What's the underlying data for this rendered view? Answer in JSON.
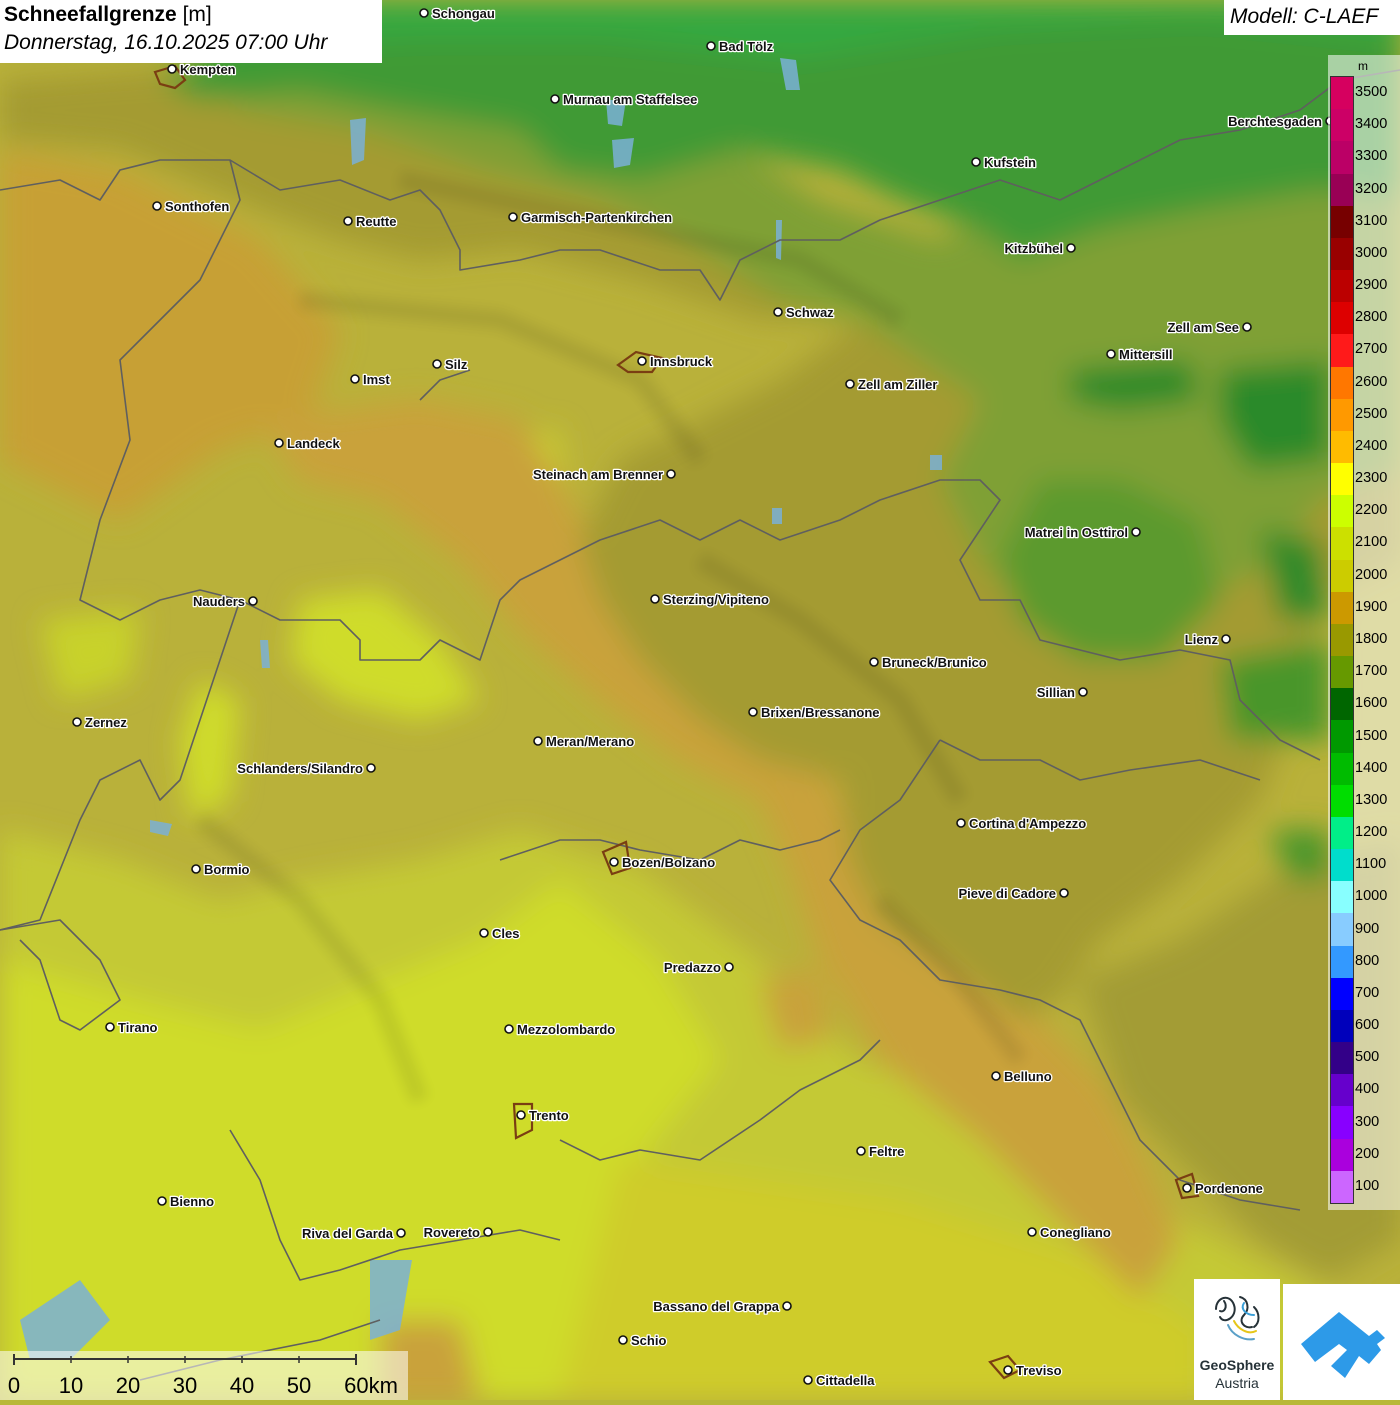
{
  "title": {
    "variable": "Schneefallgrenze",
    "unit": "[m]",
    "datetime": "Donnerstag, 16.10.2025 07:00 Uhr"
  },
  "model": "Modell: C-LAEF",
  "legend": {
    "unit": "m",
    "entries": [
      {
        "label": "3500",
        "color": "#d6005f"
      },
      {
        "label": "3400",
        "color": "#cc0066"
      },
      {
        "label": "3300",
        "color": "#bb0066"
      },
      {
        "label": "3200",
        "color": "#990055"
      },
      {
        "label": "3100",
        "color": "#770000"
      },
      {
        "label": "3000",
        "color": "#990000"
      },
      {
        "label": "2900",
        "color": "#bb0000"
      },
      {
        "label": "2800",
        "color": "#dd0000"
      },
      {
        "label": "2700",
        "color": "#ff1a1a"
      },
      {
        "label": "2600",
        "color": "#ff7700"
      },
      {
        "label": "2500",
        "color": "#ff9900"
      },
      {
        "label": "2400",
        "color": "#ffbb00"
      },
      {
        "label": "2300",
        "color": "#ffff00"
      },
      {
        "label": "2200",
        "color": "#ccff00"
      },
      {
        "label": "2100",
        "color": "#cce000"
      },
      {
        "label": "2000",
        "color": "#cccc00"
      },
      {
        "label": "1900",
        "color": "#cc9900"
      },
      {
        "label": "1800",
        "color": "#999900"
      },
      {
        "label": "1700",
        "color": "#669900"
      },
      {
        "label": "1600",
        "color": "#006600"
      },
      {
        "label": "1500",
        "color": "#009900"
      },
      {
        "label": "1400",
        "color": "#00bb00"
      },
      {
        "label": "1300",
        "color": "#00dd00"
      },
      {
        "label": "1200",
        "color": "#00ee88"
      },
      {
        "label": "1100",
        "color": "#00ddcc"
      },
      {
        "label": "1000",
        "color": "#88ffff"
      },
      {
        "label": "900",
        "color": "#88ccff"
      },
      {
        "label": "800",
        "color": "#3399ff"
      },
      {
        "label": "700",
        "color": "#0000ff"
      },
      {
        "label": "600",
        "color": "#0000bb"
      },
      {
        "label": "500",
        "color": "#330088"
      },
      {
        "label": "400",
        "color": "#6600cc"
      },
      {
        "label": "300",
        "color": "#8800ff"
      },
      {
        "label": "200",
        "color": "#aa00dd"
      },
      {
        "label": "100",
        "color": "#cc66ff"
      }
    ]
  },
  "scale": {
    "labels": [
      "0",
      "10",
      "20",
      "30",
      "40",
      "50",
      "60km"
    ]
  },
  "logo": {
    "name_line1": "GeoSphere",
    "name_line2": "Austria"
  },
  "cities": [
    "Schongau",
    "Bad Tölz",
    "Kempten",
    "Murnau am Staffelsee",
    "Berchtesgaden",
    "Kufstein",
    "Sonthofen",
    "Reutte",
    "Garmisch-Partenkirchen",
    "Kitzbühel",
    "Schwaz",
    "Zell am See",
    "Innsbruck",
    "Mittersill",
    "Imst",
    "Silz",
    "Zell am Ziller",
    "Landeck",
    "Steinach am Brenner",
    "Matrei in Osttirol",
    "Nauders",
    "Sterzing/Vipiteno",
    "Lienz",
    "Bruneck/Brunico",
    "Sillian",
    "Zernez",
    "Brixen/Bressanone",
    "Meran/Merano",
    "Schlanders/Silandro",
    "Cortina d'Ampezzo",
    "Bormio",
    "Bozen/Bolzano",
    "Pieve di Cadore",
    "Cles",
    "Predazzo",
    "Tirano",
    "Mezzolombardo",
    "Belluno",
    "Trento",
    "Feltre",
    "Pordenone",
    "Bienno",
    "Riva del Garda",
    "Rovereto",
    "Conegliano",
    "Bassano del Grappa",
    "Schio",
    "Treviso",
    "Cittadella"
  ]
}
